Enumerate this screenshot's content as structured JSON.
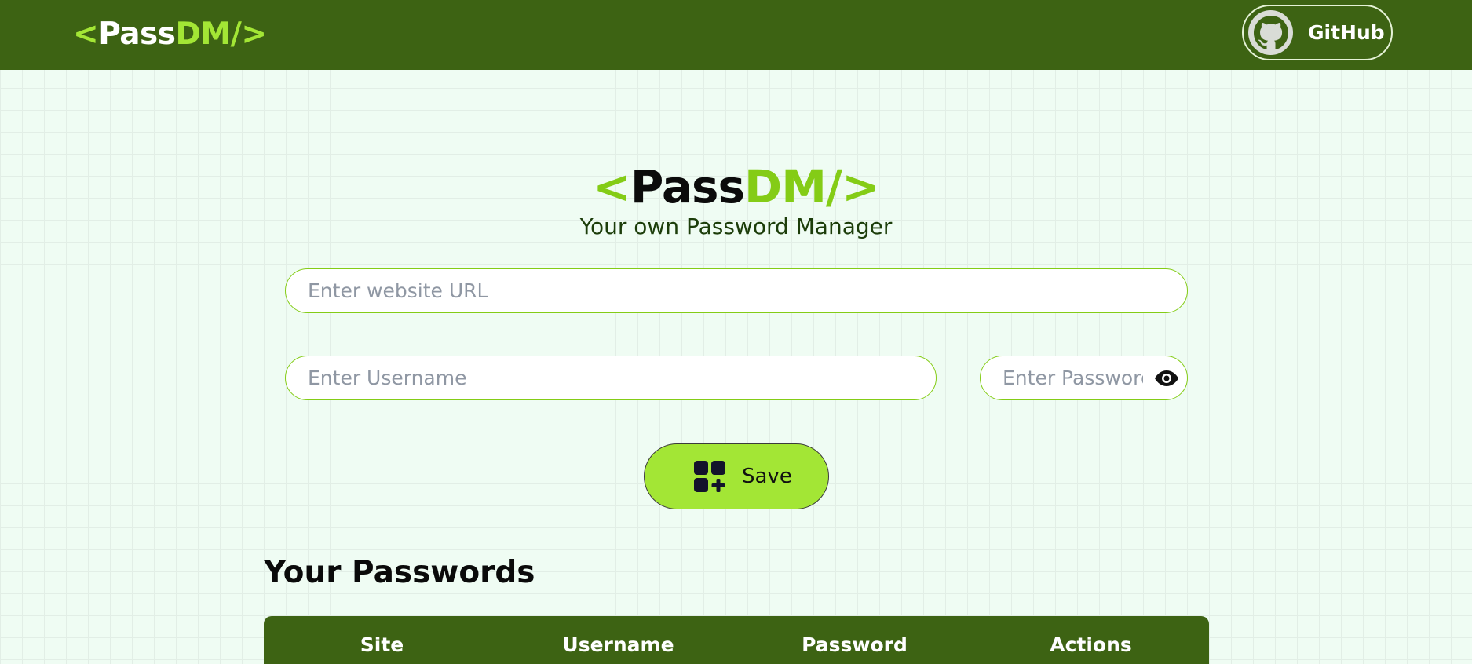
{
  "navbar": {
    "logo": {
      "open": "<",
      "pass": "Pass",
      "dm": "DM/",
      "close": ">"
    },
    "github_label": "GitHub"
  },
  "hero": {
    "logo": {
      "open": "<",
      "pass": "Pass",
      "dm": "DM/",
      "close": ">"
    },
    "subtitle": "Your own Password Manager"
  },
  "form": {
    "url_placeholder": "Enter website URL",
    "url_value": "",
    "username_placeholder": "Enter Username",
    "username_value": "",
    "password_placeholder": "Enter Password",
    "password_value": "",
    "password_toggle_icon": "eye-icon",
    "save_label": "Save",
    "save_icon": "add-grid-icon"
  },
  "passwords": {
    "title": "Your Passwords",
    "columns": [
      "Site",
      "Username",
      "Password",
      "Actions"
    ],
    "rows": []
  },
  "colors": {
    "nav_bg": "#3d6313",
    "accent": "#a3e635",
    "accent_dark": "#84cc16",
    "page_bg": "#effcf3"
  }
}
